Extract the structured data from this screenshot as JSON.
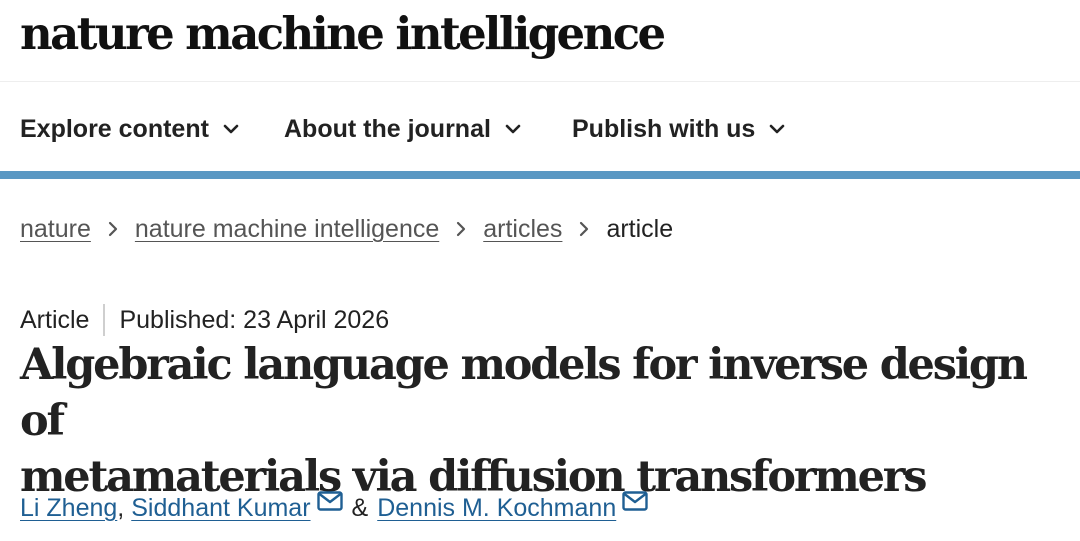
{
  "site": {
    "logo_text": "nature machine intelligence"
  },
  "nav": {
    "items": [
      {
        "label": "Explore content",
        "icon": "chevron-down-icon"
      },
      {
        "label": "About the journal",
        "icon": "chevron-down-icon"
      },
      {
        "label": "Publish with us",
        "icon": "chevron-down-icon"
      }
    ]
  },
  "breadcrumb": {
    "items": [
      {
        "label": "nature",
        "link": true
      },
      {
        "label": "nature machine intelligence",
        "link": true
      },
      {
        "label": "articles",
        "link": true
      },
      {
        "label": "article",
        "link": false
      }
    ],
    "separator_icon": "chevron-right-icon"
  },
  "article": {
    "type": "Article",
    "published": "Published: 23 April 2026",
    "title_line1": "Algebraic language models for inverse design of",
    "title_line2": "metamaterials via diffusion transformers",
    "authors": [
      {
        "name": "Li Zheng",
        "email_icon": false
      },
      {
        "name": "Siddhant Kumar",
        "email_icon": true
      },
      {
        "name": "Dennis M. Kochmann",
        "email_icon": true
      }
    ],
    "author_separators": [
      ",",
      "&"
    ]
  },
  "colors": {
    "nav_accent": "#5a98c3",
    "link": "#1f5f93",
    "text": "#222222"
  }
}
